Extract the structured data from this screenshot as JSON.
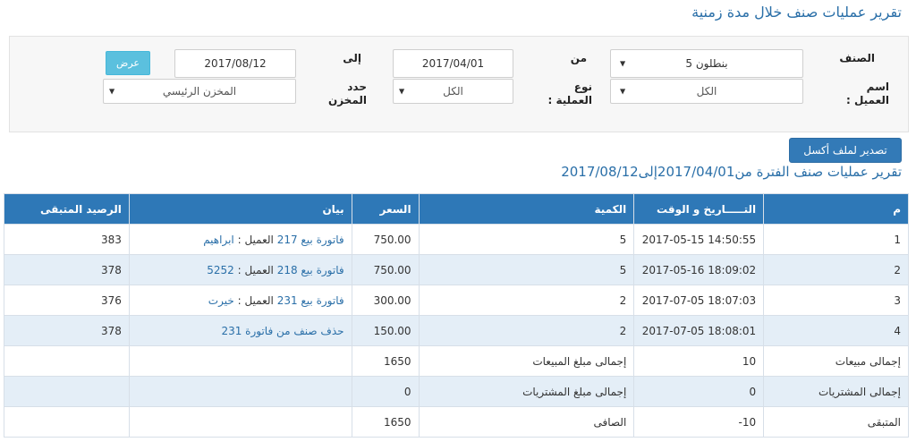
{
  "page": {
    "title": "تقرير عمليات صنف خلال مدة زمنية"
  },
  "filters": {
    "item_label": "الصنف",
    "item_value": "بنطلون 5",
    "from_label": "من",
    "from_value": "2017/04/01",
    "to_label": "إلى",
    "to_value": "2017/08/12",
    "show_button": "عرض",
    "customer_label_1": "اسم",
    "customer_label_2": "العميل :",
    "customer_value": "الكل",
    "optype_label_1": "نوع",
    "optype_label_2": "العملية :",
    "optype_value": "الكل",
    "store_label_1": "حدد",
    "store_label_2": "المخزن",
    "store_value": "المخزن الرئيسي"
  },
  "export_button": "تصدير لملف أكسل",
  "report": {
    "title": "تقرير عمليات صنف الفترة من2017/04/01إلى2017/08/12"
  },
  "table": {
    "headers": {
      "num": "م",
      "datetime": "التـــــاريخ و الوقت",
      "qty": "الكمية",
      "price": "السعر",
      "desc": "بيان",
      "balance": "الرصيد المتبقى"
    },
    "rows": [
      {
        "num": "1",
        "datetime": "2017-05-15 14:50:55",
        "qty": "5",
        "price": "750.00",
        "desc_link": "فاتورة بيع 217",
        "desc_text": " العميل : ",
        "desc_link2": "ابراهيم",
        "balance": "383"
      },
      {
        "num": "2",
        "datetime": "2017-05-16 18:09:02",
        "qty": "5",
        "price": "750.00",
        "desc_link": "فاتورة بيع 218",
        "desc_text": " العميل : ",
        "desc_link2": "5252",
        "balance": "378"
      },
      {
        "num": "3",
        "datetime": "2017-07-05 18:07:03",
        "qty": "2",
        "price": "300.00",
        "desc_link": "فاتورة بيع 231",
        "desc_text": " العميل : ",
        "desc_link2": "خيرت",
        "balance": "376"
      },
      {
        "num": "4",
        "datetime": "2017-07-05 18:08:01",
        "qty": "2",
        "price": "150.00",
        "desc_link": "حذف صنف من فاتورة 231",
        "desc_text": "",
        "desc_link2": "",
        "balance": "378"
      }
    ],
    "summary": [
      {
        "label1": "إجمالى مبيعات",
        "value1": "10",
        "label2": "إجمالى مبلغ المبيعات",
        "value2": "1650"
      },
      {
        "label1": "إجمالى المشتريات",
        "value1": "0",
        "label2": "إجمالى مبلغ المشتريات",
        "value2": "0"
      },
      {
        "label1": "المتبقى",
        "value1": "-10",
        "label2": "الصافى",
        "value2": "1650"
      }
    ]
  },
  "colors": {
    "accent": "#2e78b7",
    "stripe": "#e4eef7",
    "info_button": "#5bc0de"
  },
  "icons": {
    "dropdown": "caret-down-icon"
  }
}
